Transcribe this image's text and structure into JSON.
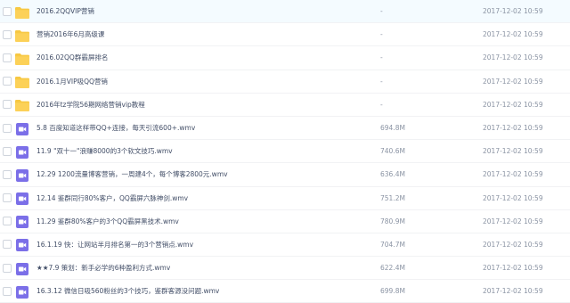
{
  "files": [
    {
      "name": "2016.2QQVIP营销",
      "size": "-",
      "date": "2017-12-02 10:59",
      "type": "folder"
    },
    {
      "name": "营销2016年6月高级课",
      "size": "-",
      "date": "2017-12-02 10:59",
      "type": "folder"
    },
    {
      "name": "2016.02QQ群霸屏排名",
      "size": "-",
      "date": "2017-12-02 10:59",
      "type": "folder"
    },
    {
      "name": "2016.1月VIP吸QQ营销",
      "size": "-",
      "date": "2017-12-02 10:59",
      "type": "folder"
    },
    {
      "name": "2016年tz学院56期网络营销vip教程",
      "size": "-",
      "date": "2017-12-02 10:59",
      "type": "folder"
    },
    {
      "name": "5.8 百度知道这样带QQ+连接，每天引流600+.wmv",
      "size": "694.8M",
      "date": "2017-12-02 10:59",
      "type": "video"
    },
    {
      "name": "11.9 \"双十一\"浪赚8000的3个软文技巧.wmv",
      "size": "740.6M",
      "date": "2017-12-02 10:59",
      "type": "video"
    },
    {
      "name": "12.29 1200流量博客营销，一周建4个，每个博客2800元.wmv",
      "size": "636.4M",
      "date": "2017-12-02 10:59",
      "type": "video"
    },
    {
      "name": "12.14 鉴群同行80%客户，QQ霸屏六脉神剑.wmv",
      "size": "751.2M",
      "date": "2017-12-02 10:59",
      "type": "video"
    },
    {
      "name": "11.29 鉴群80%客户的3个QQ霸屏黑技术.wmv",
      "size": "780.9M",
      "date": "2017-12-02 10:59",
      "type": "video"
    },
    {
      "name": "16.1.19 快：让网站半月排名第一的3个营销点.wmv",
      "size": "704.7M",
      "date": "2017-12-02 10:59",
      "type": "video"
    },
    {
      "name": "★★7.9 策划：新手必学的6种盈利方式.wmv",
      "size": "622.4M",
      "date": "2017-12-02 10:59",
      "type": "video"
    },
    {
      "name": "16.3.12 微信日吸560粉丝的3个技巧，鉴群客源没问题.wmv",
      "size": "699.8M",
      "date": "2017-12-02 10:59",
      "type": "video"
    }
  ],
  "colors": {
    "folder": "#f7c843",
    "video": "#7b6fe8",
    "text": "#424e67",
    "meta": "#8a93a3"
  }
}
